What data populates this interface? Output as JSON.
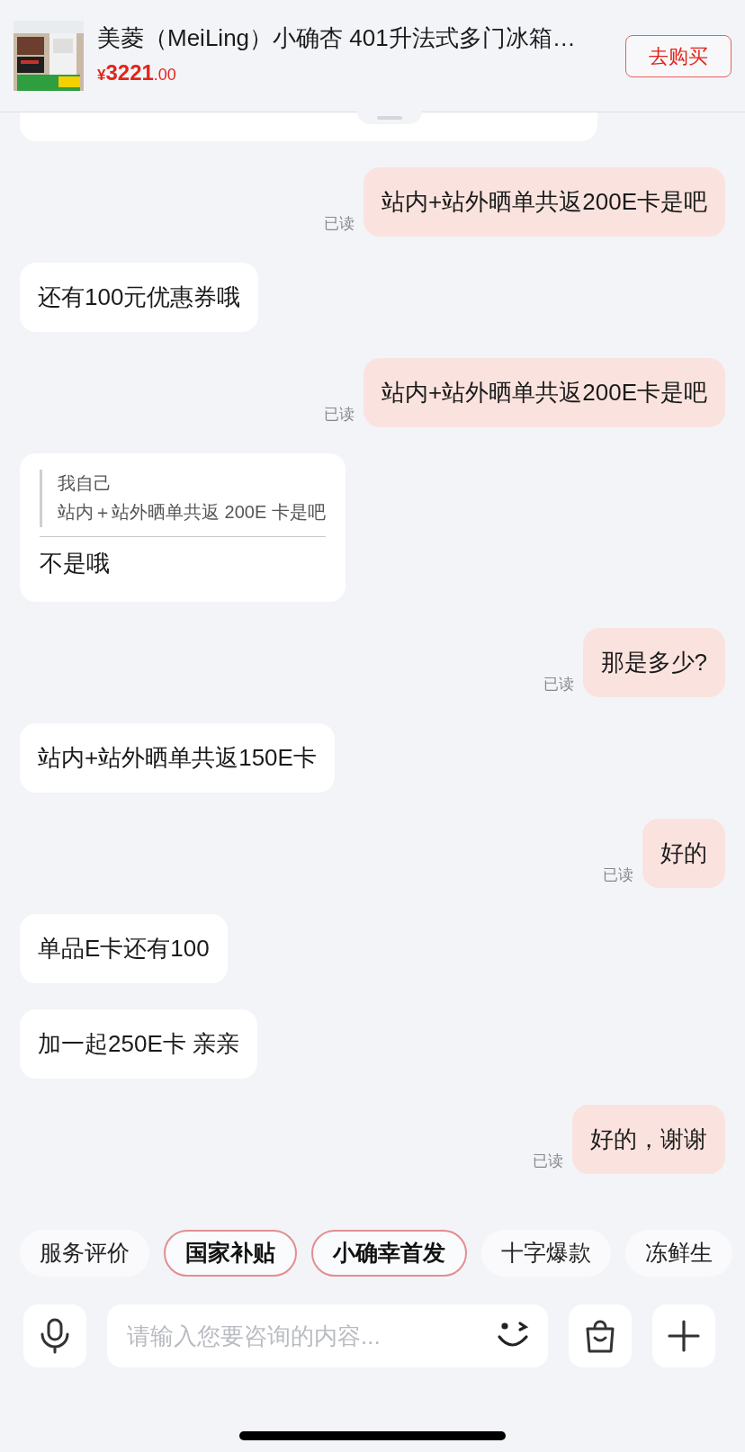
{
  "product": {
    "kind": "picture",
    "title": "美菱（MeiLing）小确杏 401升法式多门冰箱…",
    "price_symbol": "¥",
    "price_integer": "3221",
    "price_decimal": ".00",
    "buy_button": "去购买"
  },
  "messages": [
    {
      "outgoing": true,
      "kind": "text",
      "text": "站内+站外晒单共返200E卡是吧",
      "receipt": "已读"
    },
    {
      "outgoing": false,
      "kind": "text",
      "text": "还有100元优惠券哦"
    },
    {
      "outgoing": true,
      "kind": "text",
      "text": "站内+站外晒单共返200E卡是吧",
      "receipt": "已读"
    },
    {
      "outgoing": false,
      "kind": "quote",
      "quote_author": "我自己",
      "quote_text": "站内＋站外晒单共返 200E 卡是吧",
      "text": "不是哦"
    },
    {
      "outgoing": true,
      "kind": "text",
      "text": "那是多少?",
      "receipt": "已读"
    },
    {
      "outgoing": false,
      "kind": "text",
      "text": "站内+站外晒单共返150E卡"
    },
    {
      "outgoing": true,
      "kind": "text",
      "text": "好的",
      "receipt": "已读"
    },
    {
      "outgoing": false,
      "kind": "text",
      "text": "单品E卡还有100"
    },
    {
      "outgoing": false,
      "kind": "text",
      "text": "加一起250E卡 亲亲"
    },
    {
      "outgoing": true,
      "kind": "text",
      "text": "好的，谢谢",
      "receipt": "已读"
    }
  ],
  "quick_chips": [
    {
      "label": "服务评价",
      "highlighted": false
    },
    {
      "label": "国家补贴",
      "highlighted": true
    },
    {
      "label": "小确幸首发",
      "highlighted": true
    },
    {
      "label": "十字爆款",
      "highlighted": false
    },
    {
      "label": "冻鲜生",
      "highlighted": false
    }
  ],
  "input": {
    "placeholder": "请输入您要咨询的内容..."
  }
}
